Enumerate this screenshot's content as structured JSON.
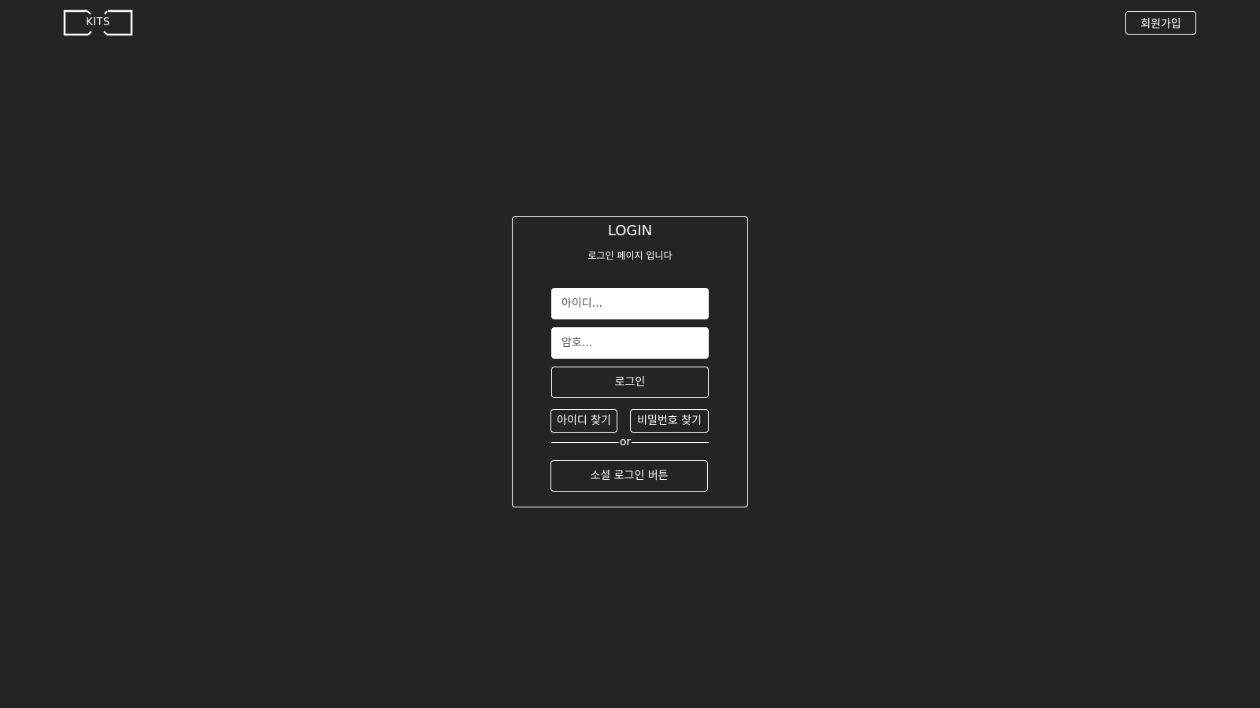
{
  "header": {
    "logo_text": "KITS",
    "signup_label": "회원가입"
  },
  "login": {
    "title": "LOGIN",
    "subtitle": "로그인 페이지 입니다",
    "id_placeholder": "아이디...",
    "password_placeholder": "암호...",
    "login_label": "로그인",
    "find_id_label": "아이디 찾기",
    "find_password_label": "비밀번호 찾기",
    "divider_text": "or",
    "social_login_label": "소셜 로그인 버튼"
  },
  "colors": {
    "background": "#242424",
    "foreground": "#ffffff",
    "input_background": "#ffffff"
  }
}
